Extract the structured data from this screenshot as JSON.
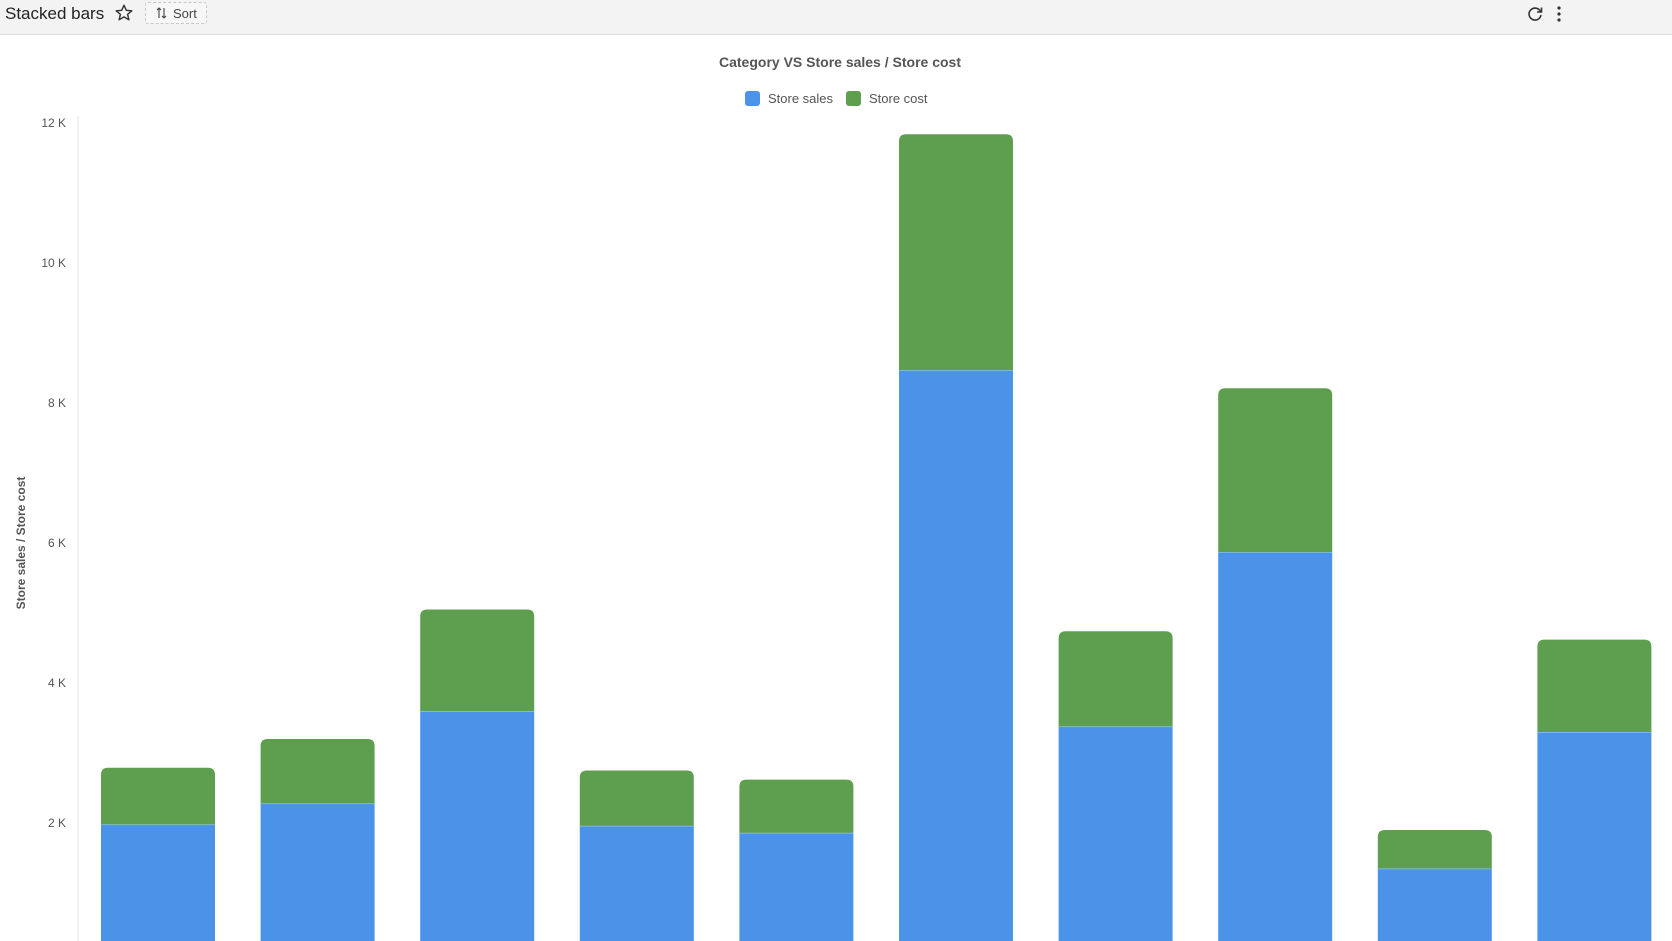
{
  "header": {
    "title": "Stacked bars",
    "sort_label": "Sort",
    "icons": [
      "star-icon",
      "sort-icon",
      "refresh-icon",
      "more-vertical-icon"
    ]
  },
  "colors": {
    "store_sales": "#4a93e8",
    "store_cost": "#5e9e4f"
  },
  "chart_data": {
    "type": "bar",
    "stacked": true,
    "title": "Category VS Store sales / Store cost",
    "xlabel": "",
    "ylabel": "Store sales / Store cost",
    "ylim": [
      0,
      12000
    ],
    "yticks": [
      {
        "value": 2000,
        "label": "2 K"
      },
      {
        "value": 4000,
        "label": "4 K"
      },
      {
        "value": 6000,
        "label": "6 K"
      },
      {
        "value": 8000,
        "label": "8 K"
      },
      {
        "value": 10000,
        "label": "10 K"
      },
      {
        "value": 12000,
        "label": "12 K"
      }
    ],
    "grid": false,
    "legend": "top-center",
    "series": [
      {
        "name": "Store sales",
        "color": "#4a93e8",
        "values": [
          1980,
          2280,
          3600,
          1960,
          1860,
          8470,
          3380,
          5870,
          1350,
          3300
        ]
      },
      {
        "name": "Store cost",
        "color": "#5e9e4f",
        "values": [
          810,
          920,
          1450,
          790,
          760,
          3370,
          1360,
          2340,
          550,
          1320
        ]
      }
    ]
  }
}
